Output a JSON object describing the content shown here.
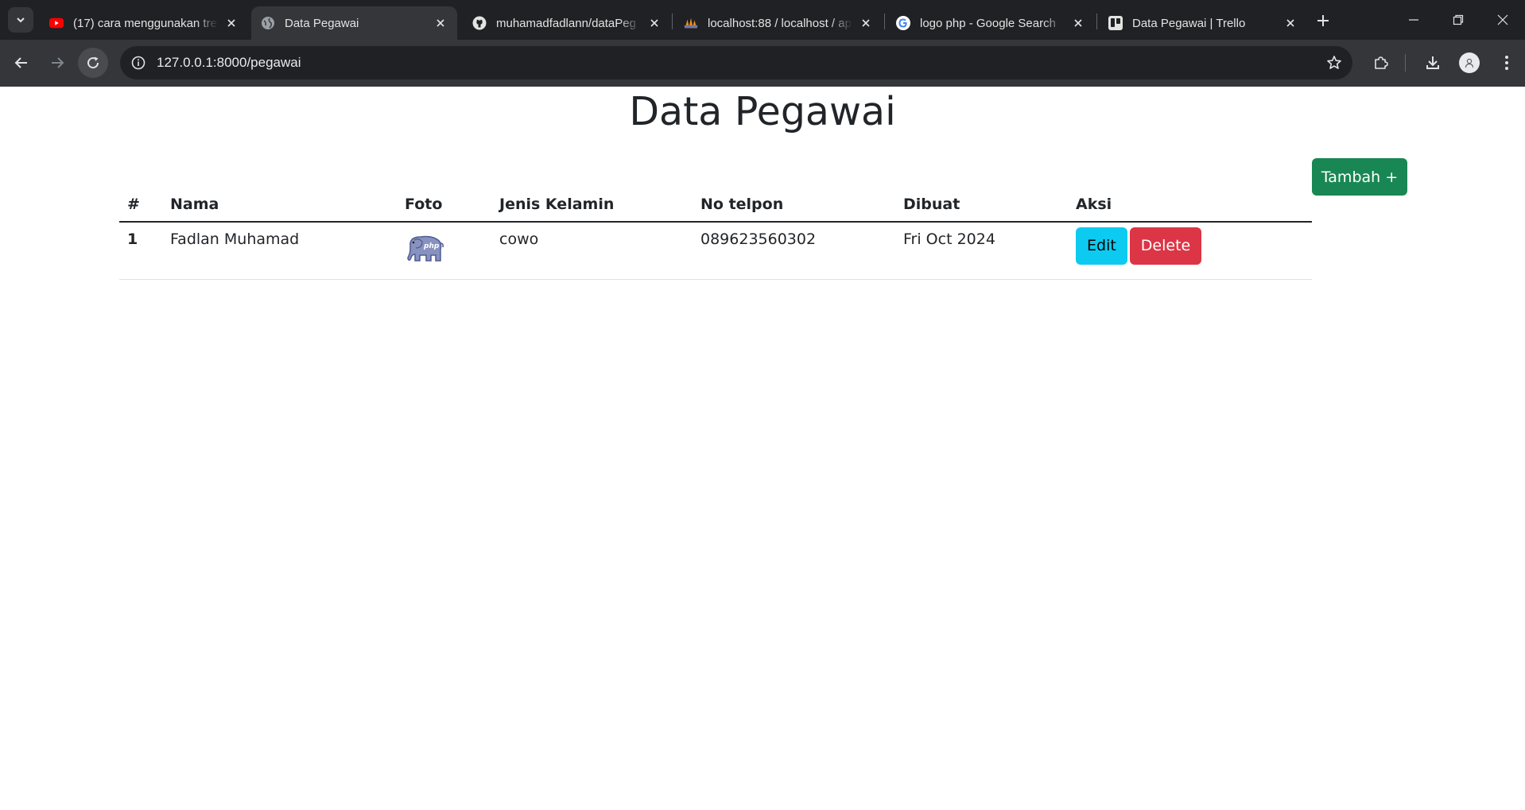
{
  "browser": {
    "tabs": [
      {
        "title": "(17) cara menggunakan tre",
        "icon": "youtube-icon",
        "active": false
      },
      {
        "title": "Data Pegawai",
        "icon": "globe-icon",
        "active": true
      },
      {
        "title": "muhamadfadlann/dataPeg",
        "icon": "github-icon",
        "active": false
      },
      {
        "title": "localhost:88 / localhost / ap",
        "icon": "phpmyadmin-icon",
        "active": false
      },
      {
        "title": "logo php - Google Search",
        "icon": "google-icon",
        "active": false
      },
      {
        "title": "Data Pegawai | Trello",
        "icon": "trello-icon",
        "active": false
      }
    ],
    "url": "127.0.0.1:8000/pegawai",
    "colors": {
      "tabstrip": "#202124",
      "toolbar": "#35363a",
      "omnibox": "#202124"
    }
  },
  "page": {
    "title": "Data Pegawai",
    "add_button": "Tambah +",
    "table": {
      "headers": {
        "no": "#",
        "nama": "Nama",
        "foto": "Foto",
        "jenis_kelamin": "Jenis Kelamin",
        "no_telpon": "No telpon",
        "dibuat": "Dibuat",
        "aksi": "Aksi"
      },
      "rows": [
        {
          "no": "1",
          "nama": "Fadlan Muhamad",
          "foto": "php-elephant-icon",
          "jenis_kelamin": "cowo",
          "no_telpon": "089623560302",
          "dibuat": "Fri Oct 2024",
          "edit_label": "Edit",
          "delete_label": "Delete"
        }
      ]
    },
    "colors": {
      "add": "#198754",
      "edit": "#0dcaf0",
      "delete": "#dc3545"
    }
  }
}
